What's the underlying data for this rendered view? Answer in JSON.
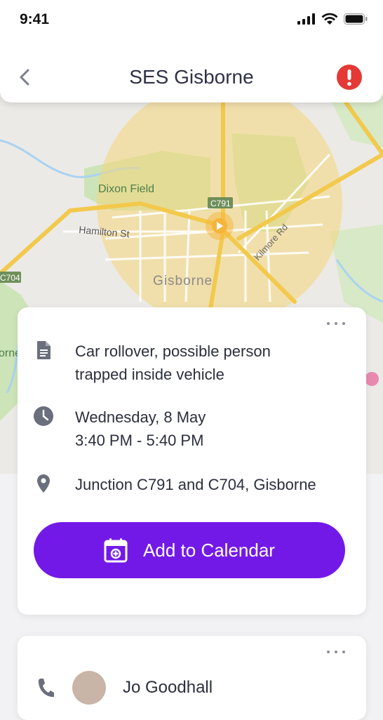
{
  "status_bar": {
    "time": "9:41"
  },
  "header": {
    "title": "SES Gisborne"
  },
  "map": {
    "labels": {
      "dixon_field": "Dixon Field",
      "hamilton_st": "Hamilton St",
      "gisborne": "Gisborne",
      "kilmore_rd": "Kilmore Rd",
      "c791": "C791",
      "c704": "C704",
      "orne": "orne"
    }
  },
  "incident": {
    "description": "Car rollover, possible person trapped inside vehicle",
    "date": "Wednesday, 8 May",
    "time": "3:40 PM - 5:40 PM",
    "location": "Junction C791 and C704, Gisborne",
    "calendar_button": "Add to Calendar"
  },
  "contact": {
    "name": "Jo Goodhall"
  },
  "colors": {
    "accent": "#7319e7",
    "alert": "#e53935",
    "radius": "#f5d67a"
  }
}
